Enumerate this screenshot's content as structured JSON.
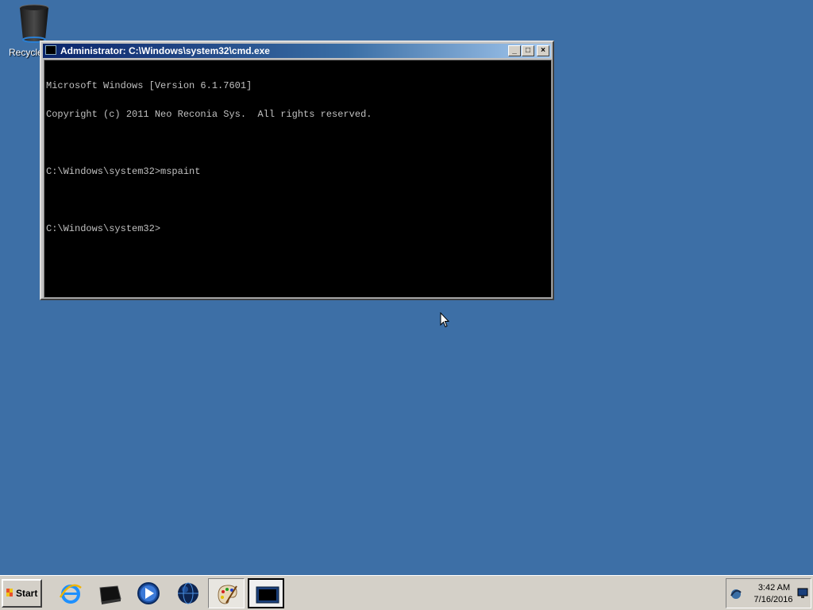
{
  "desktop": {
    "background_color": "#3d6fa6",
    "icons": [
      {
        "label": "Recycle",
        "icon": "recycle-bin-icon"
      }
    ]
  },
  "cmd_window": {
    "title": "Administrator: C:\\Windows\\system32\\cmd.exe",
    "controls": {
      "minimize": "_",
      "maximize": "□",
      "close": "×"
    },
    "lines": [
      "Microsoft Windows [Version 6.1.7601]",
      "Copyright (c) 2011 Neo Reconia Sys.  All rights reserved.",
      "",
      "C:\\Windows\\system32>mspaint",
      "",
      "C:\\Windows\\system32>"
    ]
  },
  "taskbar": {
    "start_label": "Start",
    "apps": [
      {
        "name": "internet-explorer",
        "icon": "internet-explorer-icon"
      },
      {
        "name": "file-manager",
        "icon": "black-drive-icon"
      },
      {
        "name": "media-player",
        "icon": "media-player-icon"
      },
      {
        "name": "globe",
        "icon": "globe-icon"
      },
      {
        "name": "paint",
        "icon": "paint-palette-icon",
        "state": "active"
      },
      {
        "name": "command-prompt",
        "icon": "command-prompt-icon",
        "state": "pressed"
      }
    ],
    "tray": {
      "time": "3:42 AM",
      "date": "7/16/2016",
      "icons": [
        "network-icon",
        "monitor-icon"
      ]
    }
  }
}
